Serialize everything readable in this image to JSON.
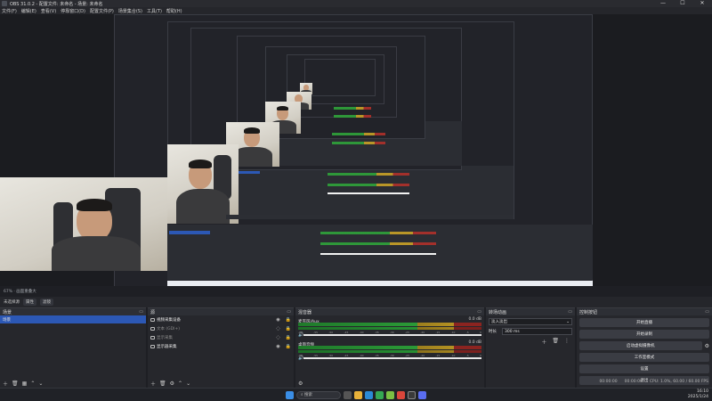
{
  "window": {
    "title": "OBS 31.0.2 - 配置文件: 未命名 - 场景: 未命名"
  },
  "menu": [
    "文件(F)",
    "编辑(E)",
    "查看(V)",
    "停靠窗口(D)",
    "配置文件(P)",
    "场景集合(S)",
    "工具(T)",
    "帮助(H)"
  ],
  "status_line": {
    "left": "67%  · 画面重叠大"
  },
  "filter_bar": {
    "scene_label": "未选择源",
    "btn_properties": "属性",
    "btn_filters": "滤镜"
  },
  "docks": {
    "scenes": {
      "title": "场景",
      "items": [
        {
          "label": "场景",
          "selected": true
        }
      ]
    },
    "sources": {
      "title": "源",
      "items": [
        {
          "label": "视频采集设备",
          "dim": false
        },
        {
          "label": "文本 (GDI+)",
          "dim": true
        },
        {
          "label": "显示采集",
          "dim": true
        },
        {
          "label": "显示器采集",
          "dim": false
        }
      ]
    },
    "mixer": {
      "title": "混音器",
      "channels": [
        {
          "name": "麦克风/Aux",
          "db": "0.0 dB"
        },
        {
          "name": "桌面音频",
          "db": "0.0 dB"
        }
      ],
      "scale": [
        "-60",
        "-55",
        "-50",
        "-45",
        "-40",
        "-35",
        "-30",
        "-25",
        "-20",
        "-15",
        "-10",
        "-5",
        "0"
      ]
    },
    "transitions": {
      "title": "转场动画",
      "selected": "淡入淡出",
      "duration_label": "时长",
      "duration_value": "300 ms"
    },
    "controls": {
      "title": "控制按钮",
      "buttons": [
        "开始直播",
        "开始录制",
        "启动虚拟摄像机",
        "工作室模式",
        "设置",
        "退出"
      ]
    }
  },
  "obs_status": {
    "stream_time": "00:00:00",
    "rec_time": "00:00:00",
    "cpu": "CPU: 1.0%, 60.00 / 60.00 FPS"
  },
  "taskbar": {
    "search_placeholder": "搜索",
    "time": "16:10",
    "date": "2025/1/24"
  },
  "colors": {
    "accent": "#2c58b5",
    "meter_green": "#2b9a37",
    "meter_yellow": "#b59222",
    "meter_red": "#8c2420"
  },
  "icons": [
    "windows-start-icon",
    "search-icon",
    "task-view-icon",
    "file-explorer-icon",
    "edge-icon",
    "chrome-icon",
    "obs-icon",
    "gear-icon"
  ]
}
